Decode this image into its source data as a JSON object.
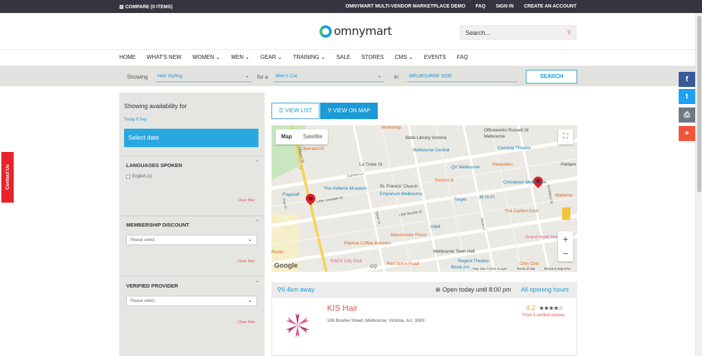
{
  "topbar": {
    "compare": "COMPARE (0 ITEMS)",
    "links": [
      "OMNYMART MULTI-VENDOR MARKETPLACE DEMO",
      "FAQ",
      "SIGN IN",
      "CREATE AN ACCOUNT"
    ]
  },
  "header": {
    "logo": "omnymart",
    "search_placeholder": "Search..."
  },
  "nav": [
    "HOME",
    "WHAT'S NEW",
    "WOMEN ⌄",
    "MEN ⌄",
    "GEAR ⌄",
    "TRAINING ⌄",
    "SALE",
    "STORES",
    "CMS ⌄",
    "EVENTS",
    "FAQ"
  ],
  "filterbar": {
    "showing_label": "Showing",
    "service": "Hair Styling",
    "for_label": "for a",
    "type": "Men's Cut",
    "in_label": "in",
    "location": "MELBOURNE 3000",
    "search_button": "SEARCH"
  },
  "contact_tab": "Contact Us",
  "social": [
    {
      "icon": "facebook-icon",
      "glyph": "f",
      "color": "#3b5998"
    },
    {
      "icon": "twitter-icon",
      "glyph": "t",
      "color": "#1da1f2"
    },
    {
      "icon": "print-icon",
      "glyph": "⎙",
      "color": "#6d7b80"
    },
    {
      "icon": "plus-icon",
      "glyph": "+",
      "color": "#f2553a"
    }
  ],
  "sidebar": {
    "title": "Showing availability for",
    "date": "Today 6 Sep",
    "select_date": "Select date",
    "languages": {
      "heading": "LANGUAGES SPOKEN",
      "option": "English (1)",
      "clear": "Clear filter"
    },
    "membership": {
      "heading": "MEMBERSHIP DISCOUNT",
      "placeholder": "Please select",
      "clear": "Clear filter"
    },
    "verified": {
      "heading": "VERIFIED PROVIDER",
      "placeholder": "Please select",
      "clear": "Clear filter"
    }
  },
  "view": {
    "list": "VIEW LIST",
    "map": "VIEW ON MAP"
  },
  "map": {
    "tab_map": "Map",
    "tab_satellite": "Satellite",
    "labels": [
      {
        "text": "Workshop",
        "color": "#d4661f"
      },
      {
        "text": "Officeworks Russell St",
        "color": "#444"
      },
      {
        "text": "State Library Victoria",
        "color": "#444"
      },
      {
        "text": "Melbourne",
        "color": "#444"
      },
      {
        "text": "Operator25",
        "color": "#d4661f"
      },
      {
        "text": "Melbourne Central",
        "color": "#1a7fb5"
      },
      {
        "text": "Comedy Theatre",
        "color": "#1a7fb5"
      },
      {
        "text": "La Trobe St",
        "color": "#555"
      },
      {
        "text": "QV Melbourne",
        "color": "#1a7fb5"
      },
      {
        "text": "Stalactites",
        "color": "#d4661f"
      },
      {
        "text": "Parliam",
        "color": "#444"
      },
      {
        "text": "The Hellenic Museum",
        "color": "#1a7fb5"
      },
      {
        "text": "St. Francis' Church",
        "color": "#444"
      },
      {
        "text": "Section 8",
        "color": "#d4661f"
      },
      {
        "text": "Chinatown Melbourne",
        "color": "#1a7fb5"
      },
      {
        "text": "Flagstaff",
        "color": "#1a7fb5"
      },
      {
        "text": "Emporium Melbourne",
        "color": "#1a7fb5"
      },
      {
        "text": "Target",
        "color": "#1a7fb5"
      },
      {
        "text": "JB Hi-Fi",
        "color": "#1a7fb5"
      },
      {
        "text": "Madame",
        "color": "#d4661f"
      },
      {
        "text": "The Carlton Club",
        "color": "#d4661f"
      },
      {
        "text": "H&M",
        "color": "#1a7fb5"
      },
      {
        "text": "Manchester Press",
        "color": "#d4661f"
      },
      {
        "text": "Grand Hyatt Mel",
        "color": "#e05590"
      },
      {
        "text": "Patricia Coffee Brewers",
        "color": "#d4661f"
      },
      {
        "text": "Melbourne Town Hall",
        "color": "#444"
      },
      {
        "text": "Rocks",
        "color": "#d4661f"
      },
      {
        "text": "RACV City Club",
        "color": "#e05590"
      },
      {
        "text": "Red Spice Road",
        "color": "#d4661f"
      },
      {
        "text": "Regent Theatre",
        "color": "#1a7fb5"
      },
      {
        "text": "Chin Chin",
        "color": "#d4661f"
      },
      {
        "text": "Block Arc",
        "color": "#1a7fb5"
      },
      {
        "text": "CQ",
        "color": "#444"
      },
      {
        "text": "Google",
        "color": "#555"
      },
      {
        "text": "Map data ©2018 Google",
        "color": "#333"
      },
      {
        "text": "Terms of Use",
        "color": "#333"
      },
      {
        "text": "Report a map error",
        "color": "#333"
      }
    ],
    "streets": [
      {
        "text": "William St",
        "color": "#555"
      },
      {
        "text": "Little Lonsdale St",
        "color": "#555"
      },
      {
        "text": "Little Bourke St",
        "color": "#555"
      },
      {
        "text": "Exhibition St",
        "color": "#555"
      },
      {
        "text": "Guildford Ln",
        "color": "#555"
      },
      {
        "text": "Queen St",
        "color": "#555"
      },
      {
        "text": "Royal Ln",
        "color": "#555"
      },
      {
        "text": "Park St",
        "color": "#555"
      }
    ]
  },
  "listing": {
    "distance": "0.4km away",
    "open": "Open today until 8:00 pm",
    "all_hours": "All opening hours",
    "name": "KIS Hair",
    "address": "108 Bourke Street, Melbourne, Victoria, AU, 3000",
    "rating": "4.2",
    "stars": "★★★★☆",
    "reviews": "From 5 verified reviews"
  }
}
